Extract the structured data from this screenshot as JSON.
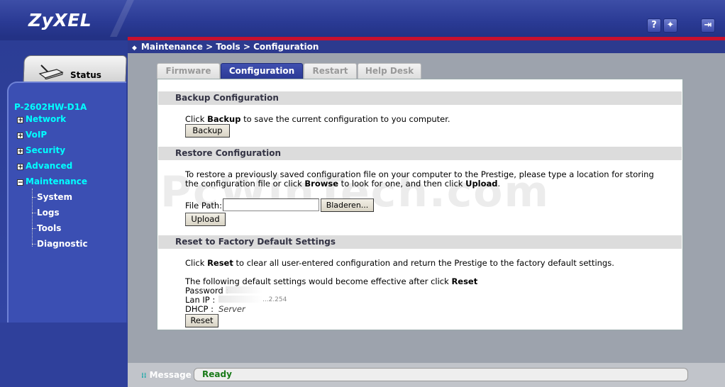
{
  "header": {
    "logo": "ZyXEL",
    "help_icon": "?",
    "wizard_icon": "✦",
    "logout_icon": "⇥"
  },
  "breadcrumb": "Maintenance > Tools > Configuration",
  "sidebar": {
    "status_label": "Status",
    "model": "P-2602HW-D1A",
    "items": [
      {
        "label": "Network",
        "box": "+"
      },
      {
        "label": "VoIP",
        "box": "+"
      },
      {
        "label": "Security",
        "box": "+"
      },
      {
        "label": "Advanced",
        "box": "+"
      },
      {
        "label": "Maintenance",
        "box": "−"
      }
    ],
    "sub_items": [
      "System",
      "Logs",
      "Tools",
      "Diagnostic"
    ]
  },
  "tabs": [
    {
      "label": "Firmware",
      "active": false
    },
    {
      "label": "Configuration",
      "active": true
    },
    {
      "label": "Restart",
      "active": false
    },
    {
      "label": "Help Desk",
      "active": false
    }
  ],
  "backup": {
    "title": "Backup Configuration",
    "text_pre": "Click ",
    "text_bold": "Backup",
    "text_post": " to save the current configuration to you computer.",
    "button": "Backup"
  },
  "restore": {
    "title": "Restore Configuration",
    "line1": "To restore a previously saved configuration file on your computer to the Prestige, please type a location for storing",
    "line2_pre": "the configuration file or click ",
    "line2_b1": "Browse",
    "line2_mid": " to look for one, and then click ",
    "line2_b2": "Upload",
    "line2_post": ".",
    "file_path_label": "File Path:",
    "file_path_value": "",
    "browse_button": "Bladeren...",
    "upload_button": "Upload"
  },
  "reset": {
    "title": "Reset to Factory Default Settings",
    "line1_pre": "Click ",
    "line1_b": "Reset",
    "line1_post": " to clear all user-entered configuration and return the Prestige to the factory default settings.",
    "line2_pre": "The following default settings would become effective after click ",
    "line2_b": "Reset",
    "password_label": "Password :",
    "lan_ip_label": "Lan IP :",
    "lan_ip_value": "...2.254",
    "dhcp_label": "DHCP :",
    "dhcp_value": "Server",
    "button": "Reset"
  },
  "watermark": "PcWinTech.com",
  "message": {
    "label": "Message",
    "text": "Ready"
  },
  "colors": {
    "header_blue": "#2a3a94",
    "accent_red": "#c8102e",
    "nav_cyan": "#00ffff",
    "ready_green": "#187a18"
  }
}
